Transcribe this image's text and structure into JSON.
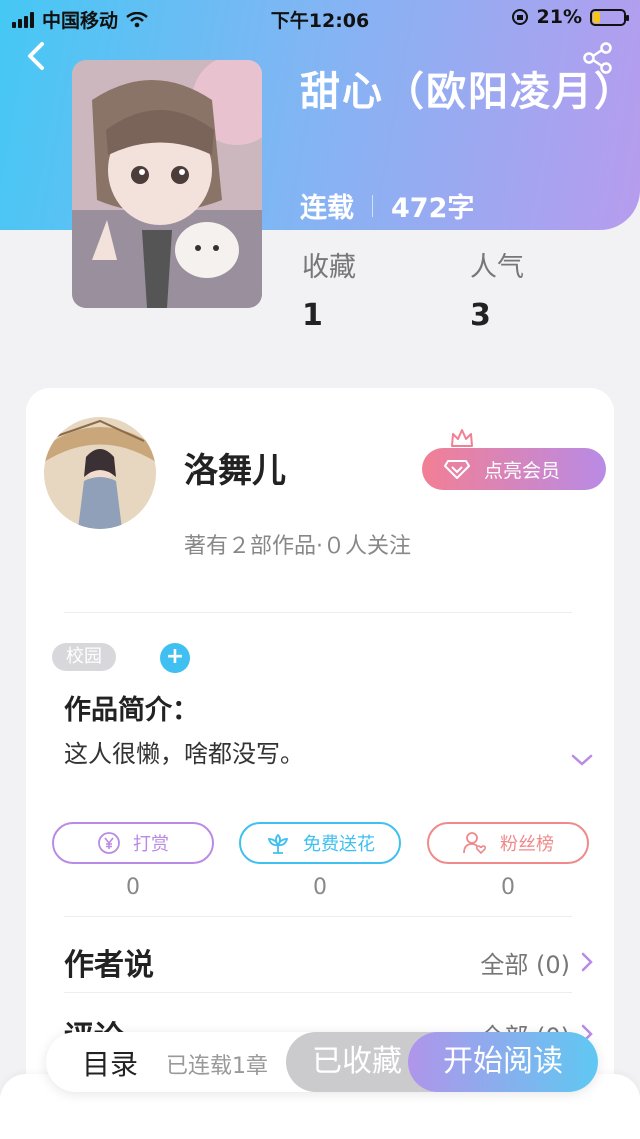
{
  "status_bar": {
    "carrier": "中国移动",
    "time": "下午12:06",
    "battery_percent": "21%",
    "battery_level": 0.21
  },
  "book": {
    "title": "甜心（欧阳凌月）",
    "status": "连载",
    "word_count": "472字"
  },
  "stats": [
    {
      "label": "收藏",
      "value": "1"
    },
    {
      "label": "人气",
      "value": "3"
    }
  ],
  "author": {
    "name": "洛舞儿",
    "summary": "著有２部作品·０人关注",
    "vip_button": "点亮会员"
  },
  "tags": [
    "校园"
  ],
  "intro": {
    "title": "作品简介：",
    "text": "这人很懒，啥都没写。"
  },
  "actions": [
    {
      "label": "打赏",
      "count": "0",
      "icon": "yen-coin-icon",
      "color": "#b98be6"
    },
    {
      "label": "免费送花",
      "count": "0",
      "icon": "flower-icon",
      "color": "#3fc0f0"
    },
    {
      "label": "粉丝榜",
      "count": "0",
      "icon": "fan-rank-icon",
      "color": "#f08a8a"
    }
  ],
  "sections": [
    {
      "title": "作者说",
      "more": "全部 (0)"
    },
    {
      "title": "评论",
      "more": "全部 (0)"
    }
  ],
  "bottom_bar": {
    "toc": "目录",
    "toc_status": "已连载1章",
    "collected": "已收藏",
    "read": "开始阅读"
  },
  "colors": {
    "accent_blue": "#45c8f4",
    "accent_purple": "#b79cee",
    "vip_pink": "#f27f94"
  }
}
